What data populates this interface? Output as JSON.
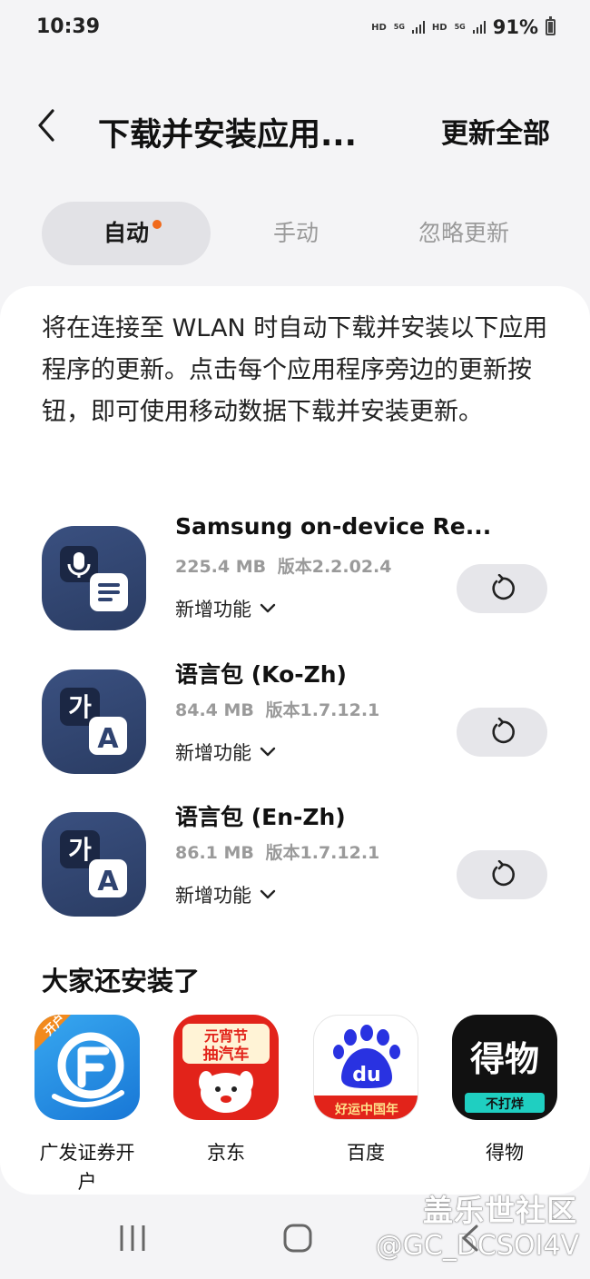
{
  "status_bar": {
    "time": "10:39",
    "network1": "HD",
    "network1_gen": "5G",
    "network2": "HD",
    "network2_gen": "5G",
    "battery": "91%"
  },
  "header": {
    "title": "下载并安装应用...",
    "update_all": "更新全部",
    "back_icon": "chevron-left-icon"
  },
  "tabs": [
    {
      "label": "自动",
      "active": true,
      "has_badge": true
    },
    {
      "label": "手动",
      "active": false
    },
    {
      "label": "忽略更新",
      "active": false
    }
  ],
  "description": "将在连接至 WLAN 时自动下载并安装以下应用程序的更新。点击每个应用程序旁边的更新按钮，即可使用移动数据下载并安装更新。",
  "apps": [
    {
      "name": "Samsung on-device Re...",
      "size": "225.4 MB",
      "version": "版本2.2.02.4",
      "whats_new": "新增功能",
      "icon": "voice-note-icon"
    },
    {
      "name": "语言包 (Ko-Zh)",
      "size": "84.4 MB",
      "version": "版本1.7.12.1",
      "whats_new": "新增功能",
      "icon": "language-pack-icon",
      "icon_glyph_1": "가",
      "icon_glyph_2": "A"
    },
    {
      "name": "语言包 (En-Zh)",
      "size": "86.1 MB",
      "version": "版本1.7.12.1",
      "whats_new": "新增功能",
      "icon": "language-pack-icon",
      "icon_glyph_1": "가",
      "icon_glyph_2": "A"
    }
  ],
  "recommended": {
    "title": "大家还安装了",
    "items": [
      {
        "label": "广发证券开户",
        "badge": "开户"
      },
      {
        "label": "京东",
        "icon_text_1": "元宵节",
        "icon_text_2": "抽汽车"
      },
      {
        "label": "百度",
        "icon_text": "du",
        "icon_banner": "好运中国年"
      },
      {
        "label": "得物",
        "icon_text": "得物",
        "icon_banner": "不打烊"
      }
    ]
  },
  "watermark": {
    "line1": "盖乐世社区",
    "line2": "@GC_DCSOI4V"
  },
  "colors": {
    "accent_dot": "#f06a1c",
    "app_icon_bg": "#2f4370",
    "jd_red": "#e2231a",
    "baidu_blue": "#2932e1",
    "gf_blue": "#1e8fe0"
  }
}
